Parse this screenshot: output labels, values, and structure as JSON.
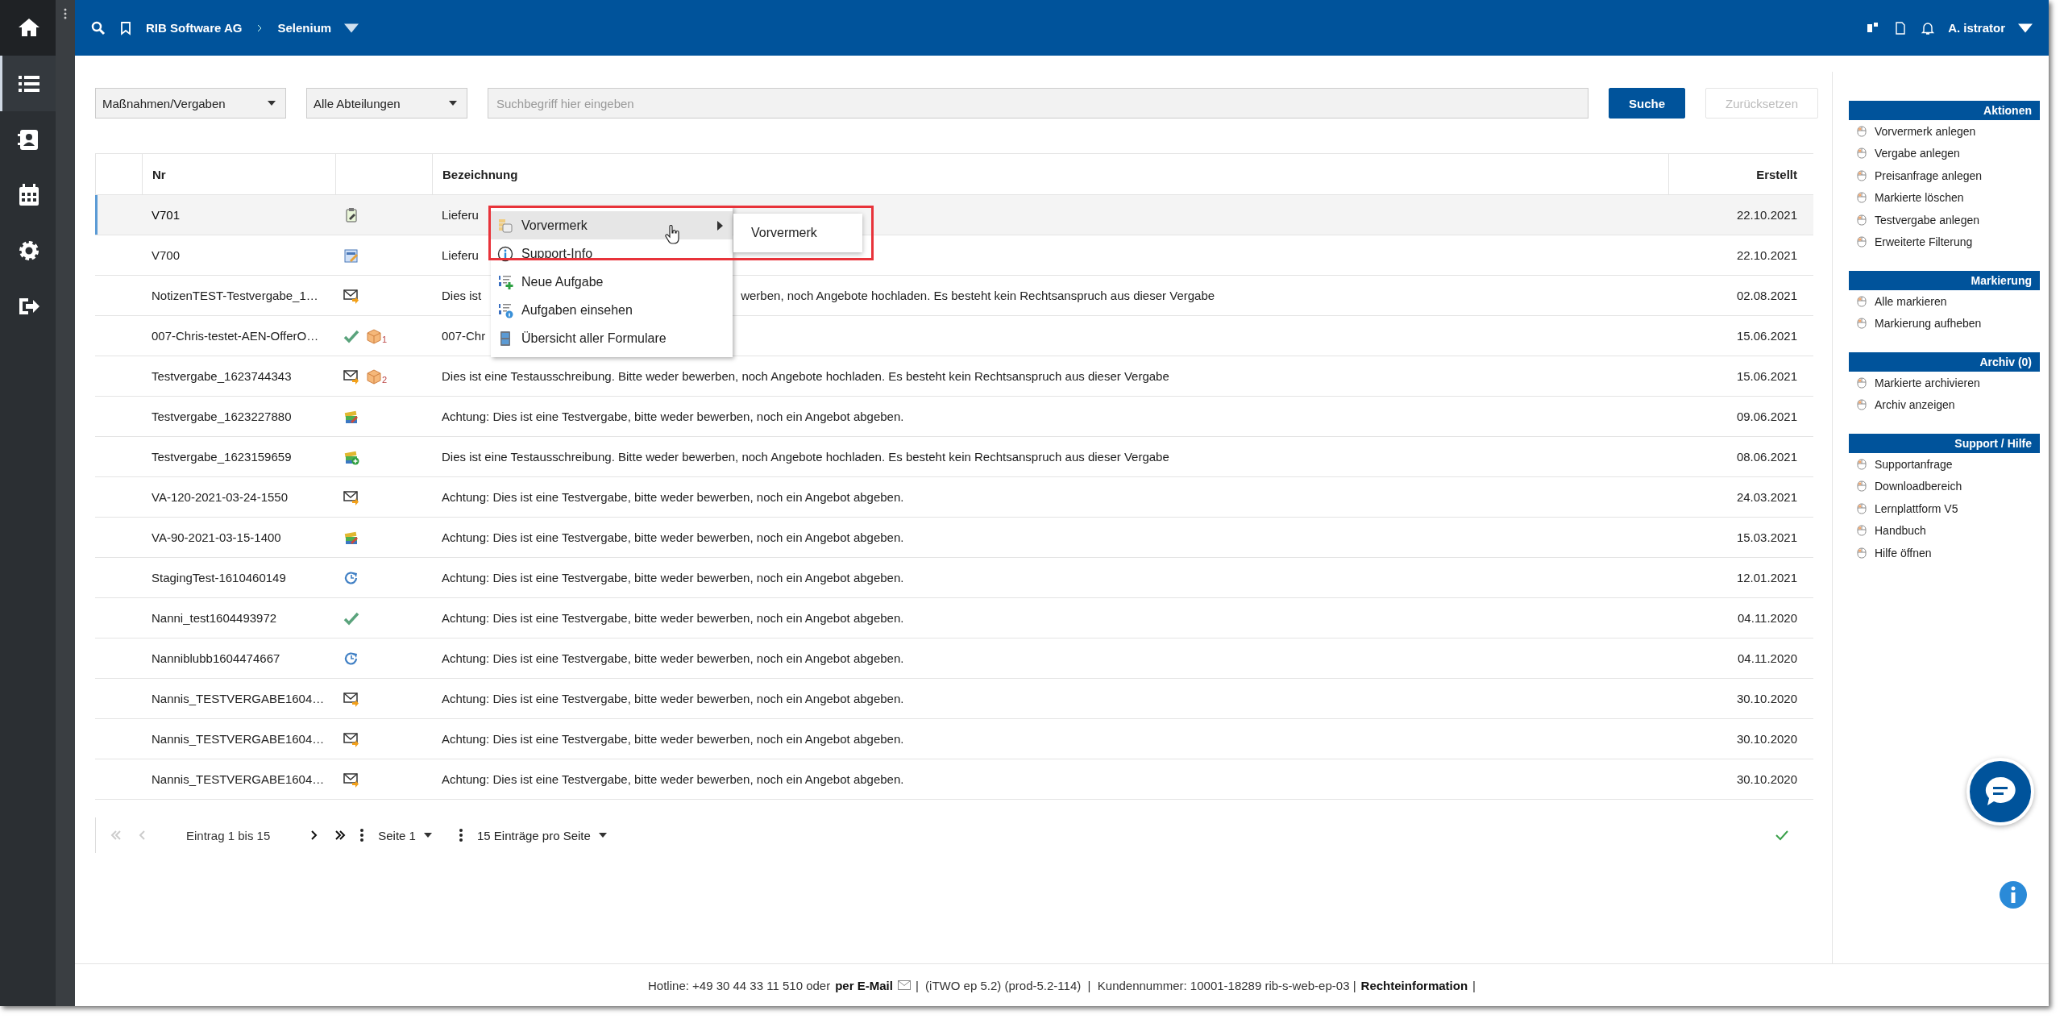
{
  "topbar": {
    "breadcrumb": [
      "RIB Software AG",
      "Selenium"
    ],
    "user": "A. istrator"
  },
  "rail": [
    {
      "kind": "home",
      "selected": false
    },
    {
      "kind": "list",
      "selected": true
    },
    {
      "kind": "contact",
      "selected": false
    },
    {
      "kind": "calendar",
      "selected": false
    },
    {
      "kind": "settings",
      "selected": false
    },
    {
      "kind": "logout",
      "selected": false
    }
  ],
  "filters": {
    "type": "Maßnahmen/Vergaben",
    "department": "Alle Abteilungen",
    "search": {
      "placeholder": "Suchbegriff hier eingeben"
    },
    "buttons": [
      {
        "label": "Suche",
        "disabled": false
      },
      {
        "label": "Zurücksetzen",
        "disabled": true
      }
    ]
  },
  "table": {
    "columns": [
      "Nr",
      "Bezeichnung",
      "Erstellt"
    ],
    "rows": [
      {
        "nr": "V701",
        "icons": [
          {
            "kind": "clipboard"
          }
        ],
        "text": "Lieferu",
        "date": "22.10.2021",
        "selected": true
      },
      {
        "nr": "V700",
        "icons": [
          {
            "kind": "form"
          }
        ],
        "text": "Lieferu",
        "date": "22.10.2021",
        "selected": false
      },
      {
        "nr": "NotizenTEST-Testvergabe_1…",
        "icons": [
          {
            "kind": "mail"
          }
        ],
        "text": "Dies ist",
        "text_after": "werben, noch Angebote hochladen. Es besteht kein Rechtsanspruch aus dieser Vergabe",
        "date": "02.08.2021",
        "selected": false
      },
      {
        "nr": "007-Chris-testet-AEN-OfferO…",
        "icons": [
          {
            "kind": "check"
          },
          {
            "kind": "package",
            "count": "1"
          }
        ],
        "text": "007-Chr",
        "date": "15.06.2021",
        "selected": false
      },
      {
        "nr": "Testvergabe_1623744343",
        "icons": [
          {
            "kind": "mail"
          },
          {
            "kind": "package",
            "count": "2"
          }
        ],
        "text": "Dies ist eine Testausschreibung. Bitte weder bewerben, noch Angebote hochladen. Es besteht kein Rechtsanspruch aus dieser Vergabe",
        "date": "15.06.2021",
        "selected": false
      },
      {
        "nr": "Testvergabe_1623227880",
        "icons": [
          {
            "kind": "books"
          }
        ],
        "text": "Achtung: Dies ist eine Testvergabe, bitte weder bewerben, noch ein Angebot abgeben.",
        "date": "09.06.2021",
        "selected": false
      },
      {
        "nr": "Testvergabe_1623159659",
        "icons": [
          {
            "kind": "books-plus"
          }
        ],
        "text": "Dies ist eine Testausschreibung. Bitte weder bewerben, noch Angebote hochladen. Es besteht kein Rechtsanspruch aus dieser Vergabe",
        "date": "08.06.2021",
        "selected": false
      },
      {
        "nr": "VA-120-2021-03-24-1550",
        "icons": [
          {
            "kind": "mail"
          }
        ],
        "text": "Achtung: Dies ist eine Testvergabe, bitte weder bewerben, noch ein Angebot abgeben.",
        "date": "24.03.2021",
        "selected": false
      },
      {
        "nr": "VA-90-2021-03-15-1400",
        "icons": [
          {
            "kind": "books"
          }
        ],
        "text": "Achtung: Dies ist eine Testvergabe, bitte weder bewerben, noch ein Angebot abgeben.",
        "date": "15.03.2021",
        "selected": false
      },
      {
        "nr": "StagingTest-1610460149",
        "icons": [
          {
            "kind": "refresh"
          }
        ],
        "text": "Achtung: Dies ist eine Testvergabe, bitte weder bewerben, noch ein Angebot abgeben.",
        "date": "12.01.2021",
        "selected": false
      },
      {
        "nr": "Nanni_test1604493972",
        "icons": [
          {
            "kind": "check"
          }
        ],
        "text": "Achtung: Dies ist eine Testvergabe, bitte weder bewerben, noch ein Angebot abgeben.",
        "date": "04.11.2020",
        "selected": false
      },
      {
        "nr": "Nanniblubb1604474667",
        "icons": [
          {
            "kind": "refresh"
          }
        ],
        "text": "Achtung: Dies ist eine Testvergabe, bitte weder bewerben, noch ein Angebot abgeben.",
        "date": "04.11.2020",
        "selected": false
      },
      {
        "nr": "Nannis_TESTVERGABE1604…",
        "icons": [
          {
            "kind": "mail"
          }
        ],
        "text": "Achtung: Dies ist eine Testvergabe, bitte weder bewerben, noch ein Angebot abgeben.",
        "date": "30.10.2020",
        "selected": false
      },
      {
        "nr": "Nannis_TESTVERGABE1604…",
        "icons": [
          {
            "kind": "mail"
          }
        ],
        "text": "Achtung: Dies ist eine Testvergabe, bitte weder bewerben, noch ein Angebot abgeben.",
        "date": "30.10.2020",
        "selected": false
      },
      {
        "nr": "Nannis_TESTVERGABE1604…",
        "icons": [
          {
            "kind": "mail"
          }
        ],
        "text": "Achtung: Dies ist eine Testvergabe, bitte weder bewerben, noch ein Angebot abgeben.",
        "date": "30.10.2020",
        "selected": false
      }
    ]
  },
  "context_menu": {
    "items": [
      {
        "label": "Vorvermerk",
        "kind": "note",
        "selected": true,
        "submenu": true
      },
      {
        "label": "Support-Info",
        "kind": "info",
        "selected": false,
        "submenu": false
      },
      {
        "label": "Neue Aufgabe",
        "kind": "task-add",
        "selected": false,
        "submenu": false
      },
      {
        "label": "Aufgaben einsehen",
        "kind": "task-info",
        "selected": false,
        "submenu": false
      },
      {
        "label": "Übersicht aller Formulare",
        "kind": "forms",
        "selected": false,
        "submenu": false
      }
    ],
    "submenu": [
      "Vorvermerk"
    ]
  },
  "pagination": {
    "range": "Eintrag 1 bis 15",
    "page": "Seite 1",
    "per_page": "15 Einträge pro Seite"
  },
  "sidebar": [
    {
      "title": "Aktionen",
      "items": [
        "Vorvermerk anlegen",
        "Vergabe anlegen",
        "Preisanfrage anlegen",
        "Markierte löschen",
        "Testvergabe anlegen",
        "Erweiterte Filterung"
      ]
    },
    {
      "title": "Markierung",
      "items": [
        "Alle markieren",
        "Markierung aufheben"
      ]
    },
    {
      "title": "Archiv (0)",
      "items": [
        "Markierte archivieren",
        "Archiv anzeigen"
      ]
    },
    {
      "title": "Support / Hilfe",
      "items": [
        "Supportanfrage",
        "Downloadbereich",
        "Lernplattform V5",
        "Handbuch",
        "Hilfe öffnen"
      ]
    }
  ],
  "footer": {
    "hotline": "Hotline: +49 30 44 33 11 510 oder",
    "email_link": "per E-Mail",
    "info": "|  (iTWO ep 5.2) (prod-5.2-114)  |  Kundennummer: 10001-18289 rib-s-web-ep-03 |",
    "legal_link": "Rechteinformation",
    "end": "|"
  }
}
